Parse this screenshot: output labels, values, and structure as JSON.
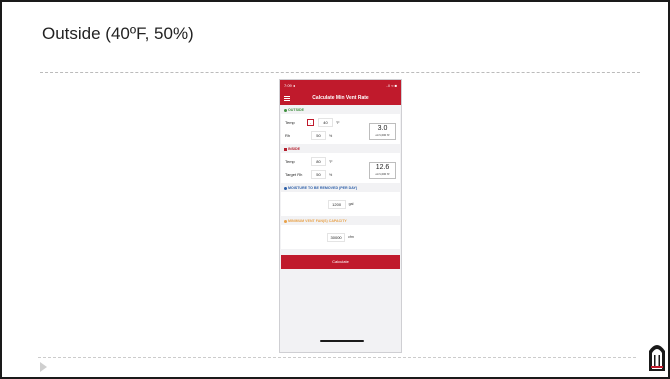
{
  "slide": {
    "title": "Outside (40ºF, 50%)"
  },
  "app": {
    "status": {
      "time": "7:09 ◂",
      "signal": "..ll ≈ ■"
    },
    "header_title": "Calculate Min Vent Rate",
    "outside": {
      "label": "OUTSIDE",
      "temp_label": "Temp",
      "temp_value": "40",
      "temp_unit": "°F",
      "minus": "-",
      "rh_label": "Rh",
      "rh_value": "50",
      "rh_unit": "%",
      "result_value": "3.0",
      "result_unit": "oz/1,000 ft³"
    },
    "inside": {
      "label": "INSIDE",
      "temp_label": "Temp",
      "temp_value": "80",
      "temp_unit": "°F",
      "rh_label": "Target Rh",
      "rh_value": "50",
      "rh_unit": "%",
      "result_value": "12.6",
      "result_unit": "oz/1,000 ft³"
    },
    "moisture": {
      "label": "MOISTURE TO BE REMOVED (PER DAY)",
      "value": "1200",
      "unit": "gal"
    },
    "fan": {
      "label": "MINIMUM VENT FAN(S) CAPACITY",
      "value": "30000",
      "unit": "cfm"
    },
    "calculate_label": "Calculate"
  },
  "colors": {
    "brand_red": "#c01a2c",
    "outside_green": "#3f8f3f",
    "moisture_blue": "#2d5fa8",
    "fan_orange": "#e8a24a"
  },
  "icons": [
    "play-icon",
    "menu-icon",
    "university-arch-logo"
  ]
}
